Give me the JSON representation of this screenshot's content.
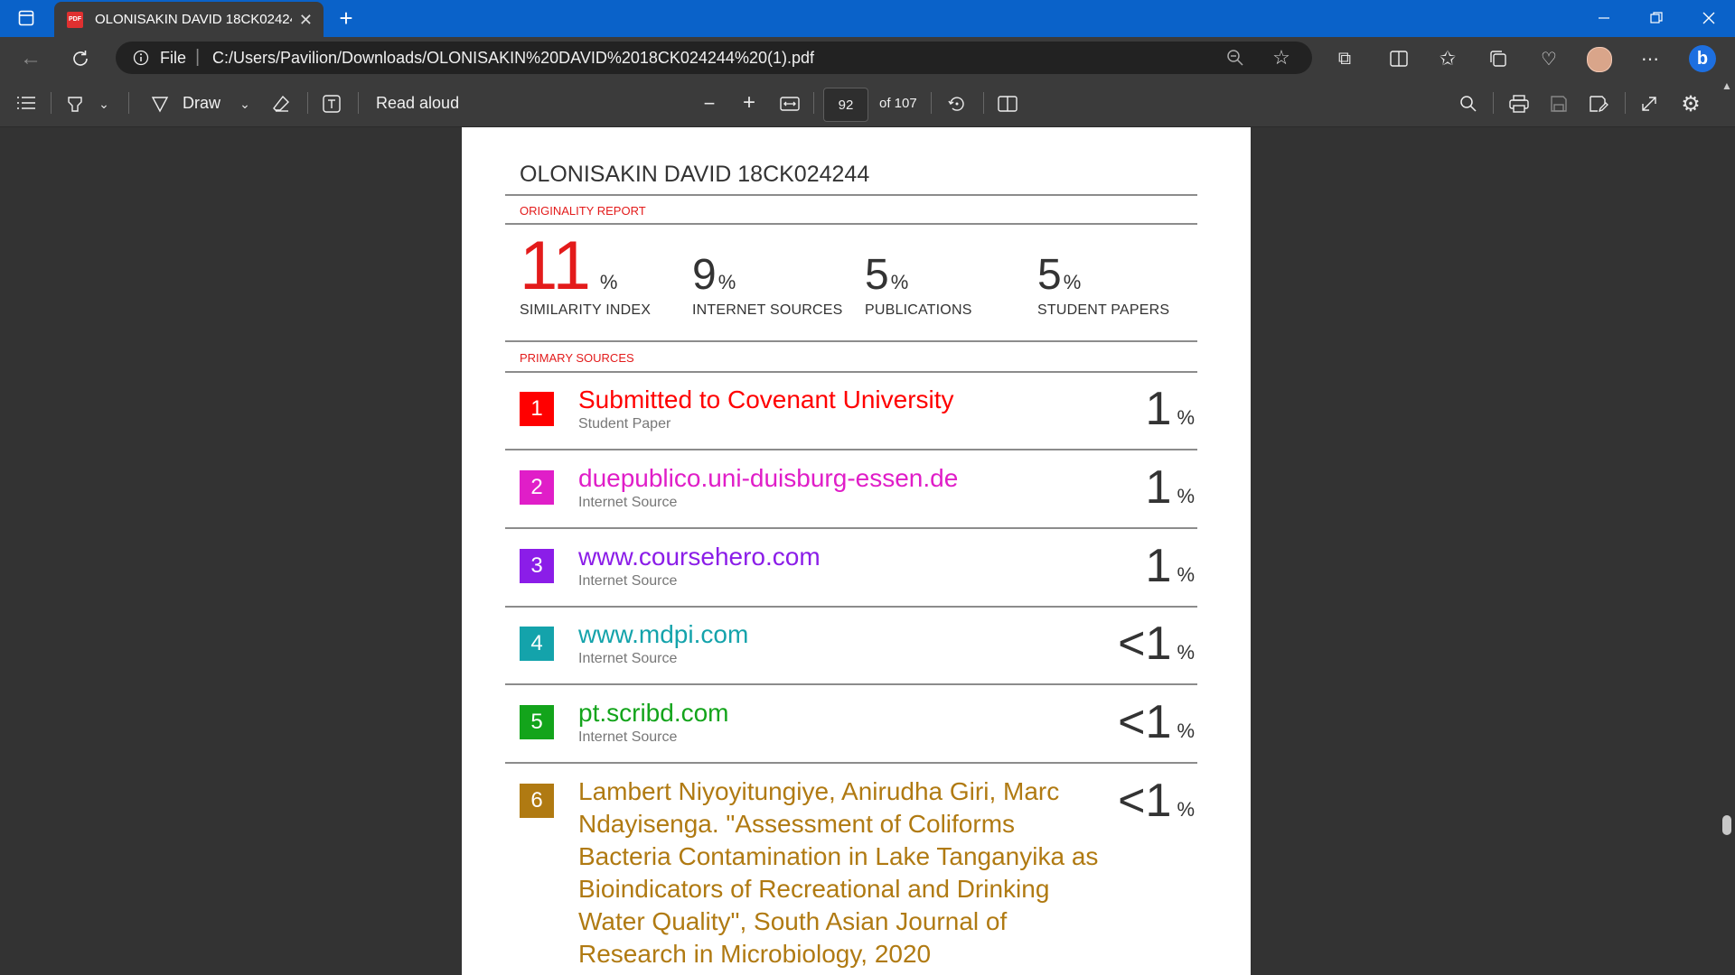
{
  "browser": {
    "tab_title": "OLONISAKIN DAVID 18CK024244",
    "tab_pdf_badge": "PDF",
    "address": "C:/Users/Pavilion/Downloads/OLONISAKIN%20DAVID%2018CK024244%20(1).pdf",
    "address_prefix": "File"
  },
  "pdf_toolbar": {
    "draw_label": "Draw",
    "read_aloud_label": "Read aloud",
    "page_number": "92",
    "page_of": "of 107"
  },
  "report": {
    "doc_title": "OLONISAKIN DAVID 18CK024244",
    "originality_label": "ORIGINALITY REPORT",
    "primary_sources_label": "PRIMARY SOURCES",
    "stats": [
      {
        "value": "11",
        "unit": "%",
        "label": "SIMILARITY INDEX",
        "color": "#e31b1b"
      },
      {
        "value": "9",
        "unit": "%",
        "label": "INTERNET SOURCES",
        "color": "#333333"
      },
      {
        "value": "5",
        "unit": "%",
        "label": "PUBLICATIONS",
        "color": "#333333"
      },
      {
        "value": "5",
        "unit": "%",
        "label": "STUDENT PAPERS",
        "color": "#333333"
      }
    ],
    "sources": [
      {
        "num": "1",
        "title": "Submitted to Covenant University",
        "type": "Student Paper",
        "pct": "1",
        "unit": "%",
        "color": "#ff0000"
      },
      {
        "num": "2",
        "title": "duepublico.uni-duisburg-essen.de",
        "type": "Internet Source",
        "pct": "1",
        "unit": "%",
        "color": "#e01ec8"
      },
      {
        "num": "3",
        "title": "www.coursehero.com",
        "type": "Internet Source",
        "pct": "1",
        "unit": "%",
        "color": "#8b1de8"
      },
      {
        "num": "4",
        "title": "www.mdpi.com",
        "type": "Internet Source",
        "pct": "<1",
        "unit": "%",
        "color": "#14a3ab"
      },
      {
        "num": "5",
        "title": "pt.scribd.com",
        "type": "Internet Source",
        "pct": "<1",
        "unit": "%",
        "color": "#13a41b"
      },
      {
        "num": "6",
        "title": "Lambert Niyoyitungiye, Anirudha Giri, Marc Ndayisenga. \"Assessment of Coliforms Bacteria Contamination in Lake Tanganyika as Bioindicators of Recreational and Drinking Water Quality\", South Asian Journal of Research in Microbiology, 2020",
        "type": "",
        "pct": "<1",
        "unit": "%",
        "color": "#b07a12"
      }
    ]
  }
}
